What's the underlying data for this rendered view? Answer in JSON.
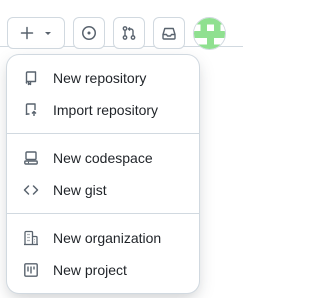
{
  "header": {
    "buttons": [
      {
        "icon": "plus-icon",
        "has_dropdown": true
      },
      {
        "icon": "issues-icon"
      },
      {
        "icon": "pull-requests-icon"
      },
      {
        "icon": "inbox-icon"
      }
    ],
    "avatar": {
      "colors": [
        "#8fe090",
        "#ffffff"
      ]
    }
  },
  "menu": {
    "groups": [
      [
        {
          "label": "New repository",
          "icon": "repo-icon"
        },
        {
          "label": "Import repository",
          "icon": "repo-push-icon"
        }
      ],
      [
        {
          "label": "New codespace",
          "icon": "codespaces-icon"
        },
        {
          "label": "New gist",
          "icon": "code-icon"
        }
      ],
      [
        {
          "label": "New organization",
          "icon": "organization-icon"
        },
        {
          "label": "New project",
          "icon": "project-icon"
        }
      ]
    ]
  },
  "colors": {
    "icon": "#59636e",
    "text": "#1f2328",
    "border": "#d1d9e0"
  }
}
